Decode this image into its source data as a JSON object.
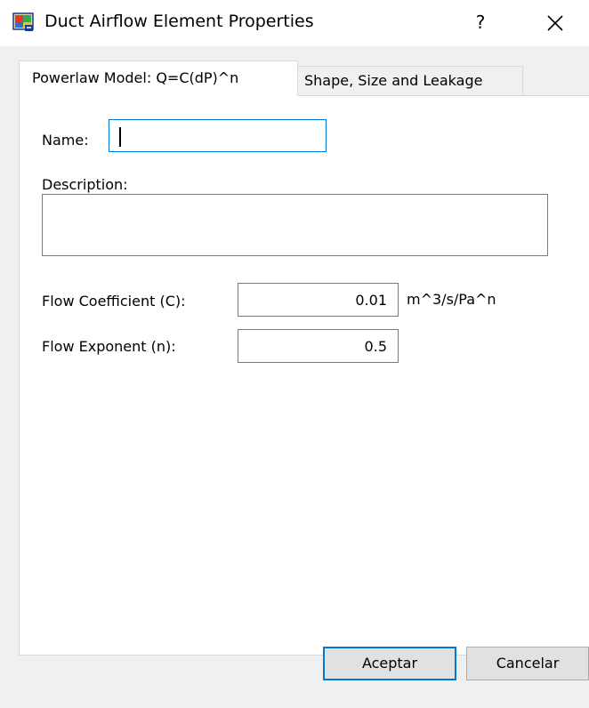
{
  "window": {
    "title": "Duct Airflow Element Properties",
    "help_label": "?",
    "icons": {
      "app": "app-icon",
      "close": "close-icon"
    }
  },
  "tabs": [
    {
      "label": "Powerlaw Model: Q=C(dP)^n",
      "active": true
    },
    {
      "label": "Shape, Size and Leakage",
      "active": false
    }
  ],
  "form": {
    "name": {
      "label": "Name:",
      "value": ""
    },
    "description": {
      "label": "Description:",
      "value": ""
    },
    "flow_coefficient": {
      "label": "Flow Coefficient (C):",
      "value": "0.01",
      "unit": "m^3/s/Pa^n"
    },
    "flow_exponent": {
      "label": "Flow Exponent (n):",
      "value": "0.5"
    }
  },
  "buttons": {
    "ok_label": "Aceptar",
    "cancel_label": "Cancelar"
  },
  "colors": {
    "focus_border": "#0078d7",
    "dialog_background": "#f0f0f0",
    "panel_background": "#ffffff"
  }
}
